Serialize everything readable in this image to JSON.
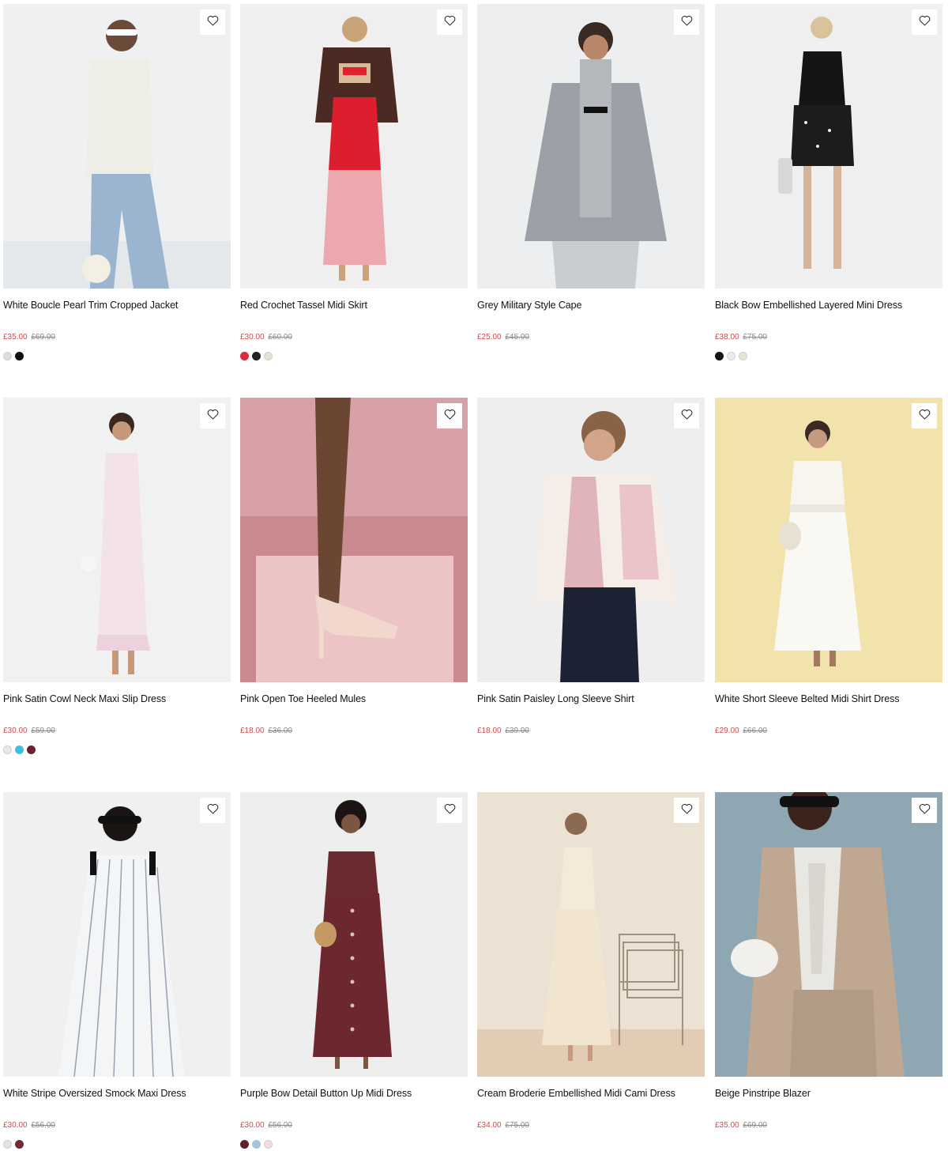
{
  "products": [
    {
      "name": "White Boucle Pearl Trim Cropped Jacket",
      "price": "£35.00",
      "was": "£69.00",
      "bg": "#eef0f1",
      "swatches": [
        "#dcdcdc",
        "#111111"
      ],
      "wishlist_icon": "heart-outline-icon"
    },
    {
      "name": "Red Crochet Tassel Midi Skirt",
      "price": "£30.00",
      "was": "£60.00",
      "bg": "#efefef",
      "swatches": [
        "#e0283c",
        "#222222",
        "#e4e2d6"
      ],
      "wishlist_icon": "heart-outline-icon"
    },
    {
      "name": "Grey Military Style Cape",
      "price": "£25.00",
      "was": "£45.00",
      "bg": "#eceeef",
      "swatches": [],
      "wishlist_icon": "heart-outline-icon"
    },
    {
      "name": "Black Bow Embellished Layered Mini Dress",
      "price": "£38.00",
      "was": "£75.00",
      "bg": "#efefef",
      "swatches": [
        "#151515",
        "#ececec",
        "#e6e4d4"
      ],
      "wishlist_icon": "heart-outline-icon"
    },
    {
      "name": "Pink Satin Cowl Neck Maxi Slip Dress",
      "price": "£30.00",
      "was": "£59.00",
      "bg": "#f1f1f1",
      "swatches": [
        "#e8e8e8",
        "#3ec0e0",
        "#6b2134"
      ],
      "wishlist_icon": "heart-outline-icon"
    },
    {
      "name": "Pink Open Toe Heeled Mules",
      "price": "£18.00",
      "was": "£36.00",
      "bg": "#c88a8e",
      "swatches": [],
      "wishlist_icon": "heart-outline-icon"
    },
    {
      "name": "Pink Satin Paisley Long Sleeve Shirt",
      "price": "£18.00",
      "was": "£39.00",
      "bg": "#eeeeee",
      "swatches": [],
      "wishlist_icon": "heart-outline-icon"
    },
    {
      "name": "White Short Sleeve Belted Midi Shirt Dress",
      "price": "£29.00",
      "was": "£66.00",
      "bg": "#f2e3ad",
      "swatches": [],
      "wishlist_icon": "heart-outline-icon"
    },
    {
      "name": "White Stripe Oversized Smock Maxi Dress",
      "price": "£30.00",
      "was": "£56.00",
      "bg": "#f0f0f0",
      "swatches": [
        "#dfe3e6",
        "#6e2b33"
      ],
      "wishlist_icon": "heart-outline-icon"
    },
    {
      "name": "Purple Bow Detail Button Up Midi Dress",
      "price": "£30.00",
      "was": "£56.00",
      "bg": "#eeeeee",
      "swatches": [
        "#5b2329",
        "#a9c3da",
        "#f3dbe2"
      ],
      "wishlist_icon": "heart-outline-icon"
    },
    {
      "name": "Cream Broderie Embellished Midi Cami Dress",
      "price": "£34.00",
      "was": "£75.00",
      "bg": "#ece2d3",
      "swatches": [],
      "wishlist_icon": "heart-outline-icon"
    },
    {
      "name": "Beige Pinstripe Blazer",
      "price": "£35.00",
      "was": "£69.00",
      "bg": "#8fa7b3",
      "swatches": [],
      "wishlist_icon": "heart-outline-icon"
    }
  ]
}
